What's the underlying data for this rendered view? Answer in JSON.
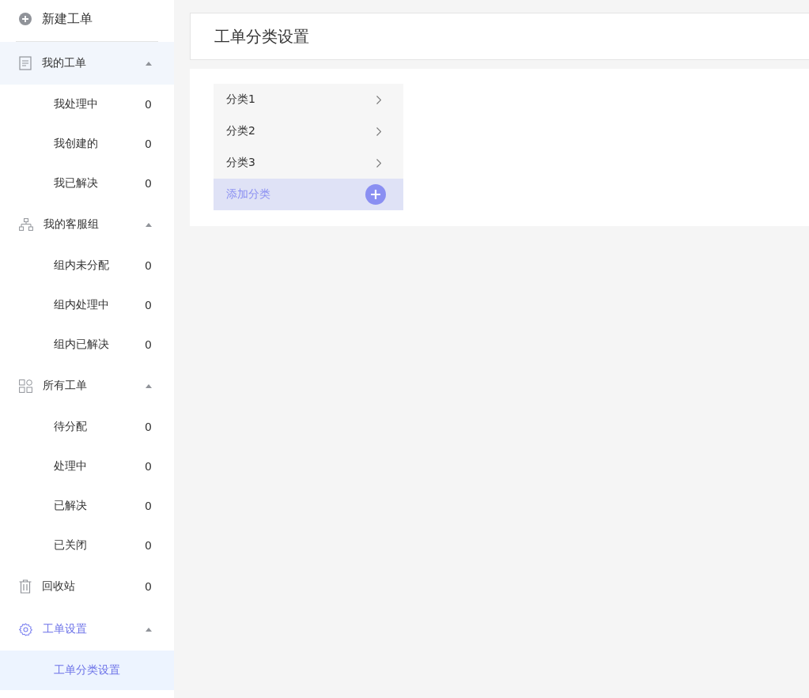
{
  "sidebar": {
    "new_ticket": "新建工单",
    "items": [
      {
        "kind": "group",
        "label": "我的工单",
        "expanded": true,
        "hovered": true,
        "selected": false,
        "children": [
          {
            "label": "我处理中",
            "count": "0",
            "selected": false
          },
          {
            "label": "我创建的",
            "count": "0",
            "selected": false
          },
          {
            "label": "我已解决",
            "count": "0",
            "selected": false
          }
        ]
      },
      {
        "kind": "group",
        "label": "我的客服组",
        "expanded": true,
        "hovered": false,
        "selected": false,
        "children": [
          {
            "label": "组内未分配",
            "count": "0",
            "selected": false
          },
          {
            "label": "组内处理中",
            "count": "0",
            "selected": false
          },
          {
            "label": "组内已解决",
            "count": "0",
            "selected": false
          }
        ]
      },
      {
        "kind": "group",
        "label": "所有工单",
        "expanded": true,
        "hovered": false,
        "selected": false,
        "children": [
          {
            "label": "待分配",
            "count": "0",
            "selected": false
          },
          {
            "label": "处理中",
            "count": "0",
            "selected": false
          },
          {
            "label": "已解决",
            "count": "0",
            "selected": false
          },
          {
            "label": "已关闭",
            "count": "0",
            "selected": false
          }
        ]
      },
      {
        "kind": "item",
        "label": "回收站",
        "count": "0",
        "hovered": false,
        "selected": false
      },
      {
        "kind": "group",
        "label": "工单设置",
        "expanded": true,
        "hovered": false,
        "selected": true,
        "children": [
          {
            "label": "工单分类设置",
            "selected": true
          }
        ]
      }
    ]
  },
  "page": {
    "title": "工单分类设置",
    "categories": [
      {
        "label": "分类1"
      },
      {
        "label": "分类2"
      },
      {
        "label": "分类3"
      }
    ],
    "add_category": "添加分类"
  }
}
